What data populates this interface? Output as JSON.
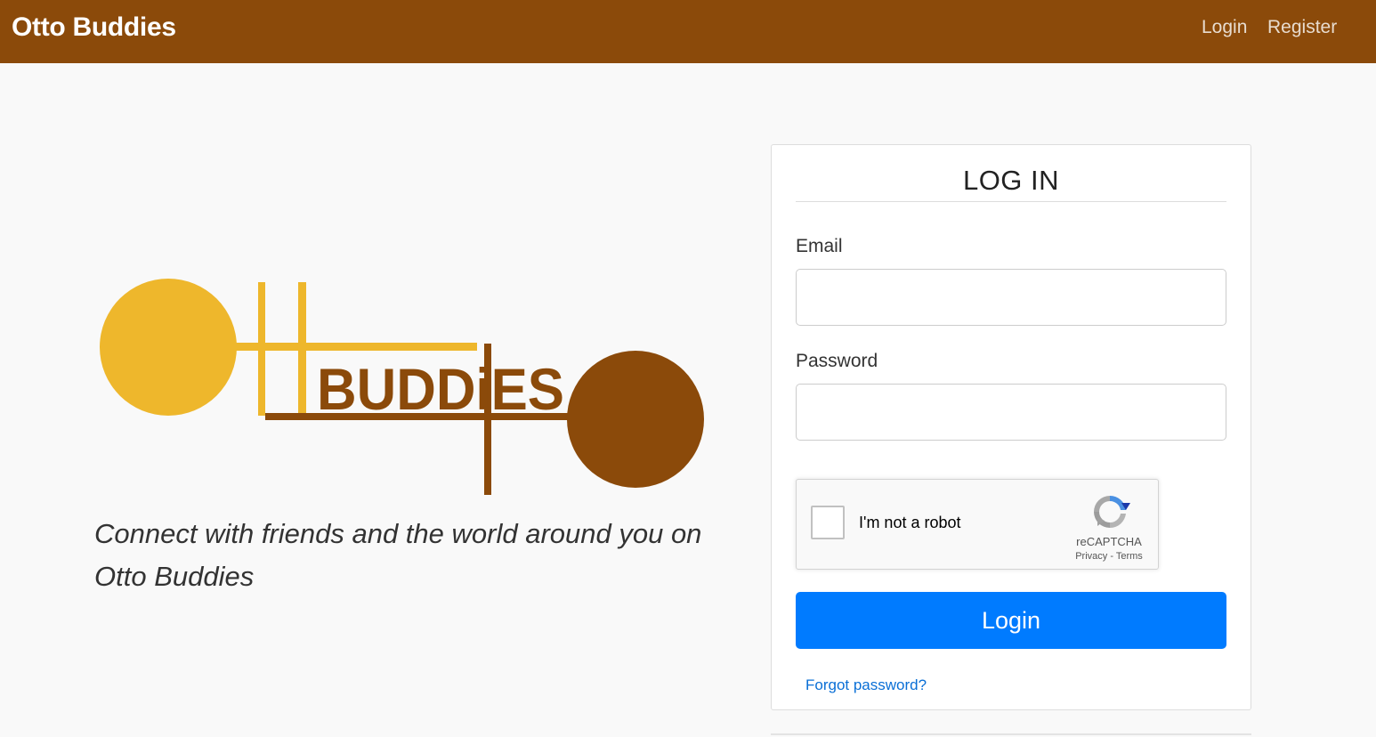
{
  "navbar": {
    "brand": "Otto Buddies",
    "links": [
      "Login",
      "Register"
    ],
    "background": "#8b4a0a"
  },
  "hero": {
    "logo": {
      "text": "BUDDiES",
      "colors": {
        "gold": "#eeb72c",
        "brown": "#8b4a0a"
      }
    },
    "tagline": "Connect with friends and the world around you on Otto Buddies"
  },
  "login_form": {
    "title": "LOG IN",
    "email_label": "Email",
    "email_value": "",
    "password_label": "Password",
    "password_value": "",
    "submit_label": "Login",
    "forgot_link": "Forgot password?",
    "button_color": "#007bff"
  },
  "recaptcha": {
    "checkbox_label": "I'm not a robot",
    "checked": false,
    "brand": "reCAPTCHA",
    "privacy": "Privacy",
    "separator": " - ",
    "terms": "Terms",
    "icon": "recaptcha-icon"
  }
}
